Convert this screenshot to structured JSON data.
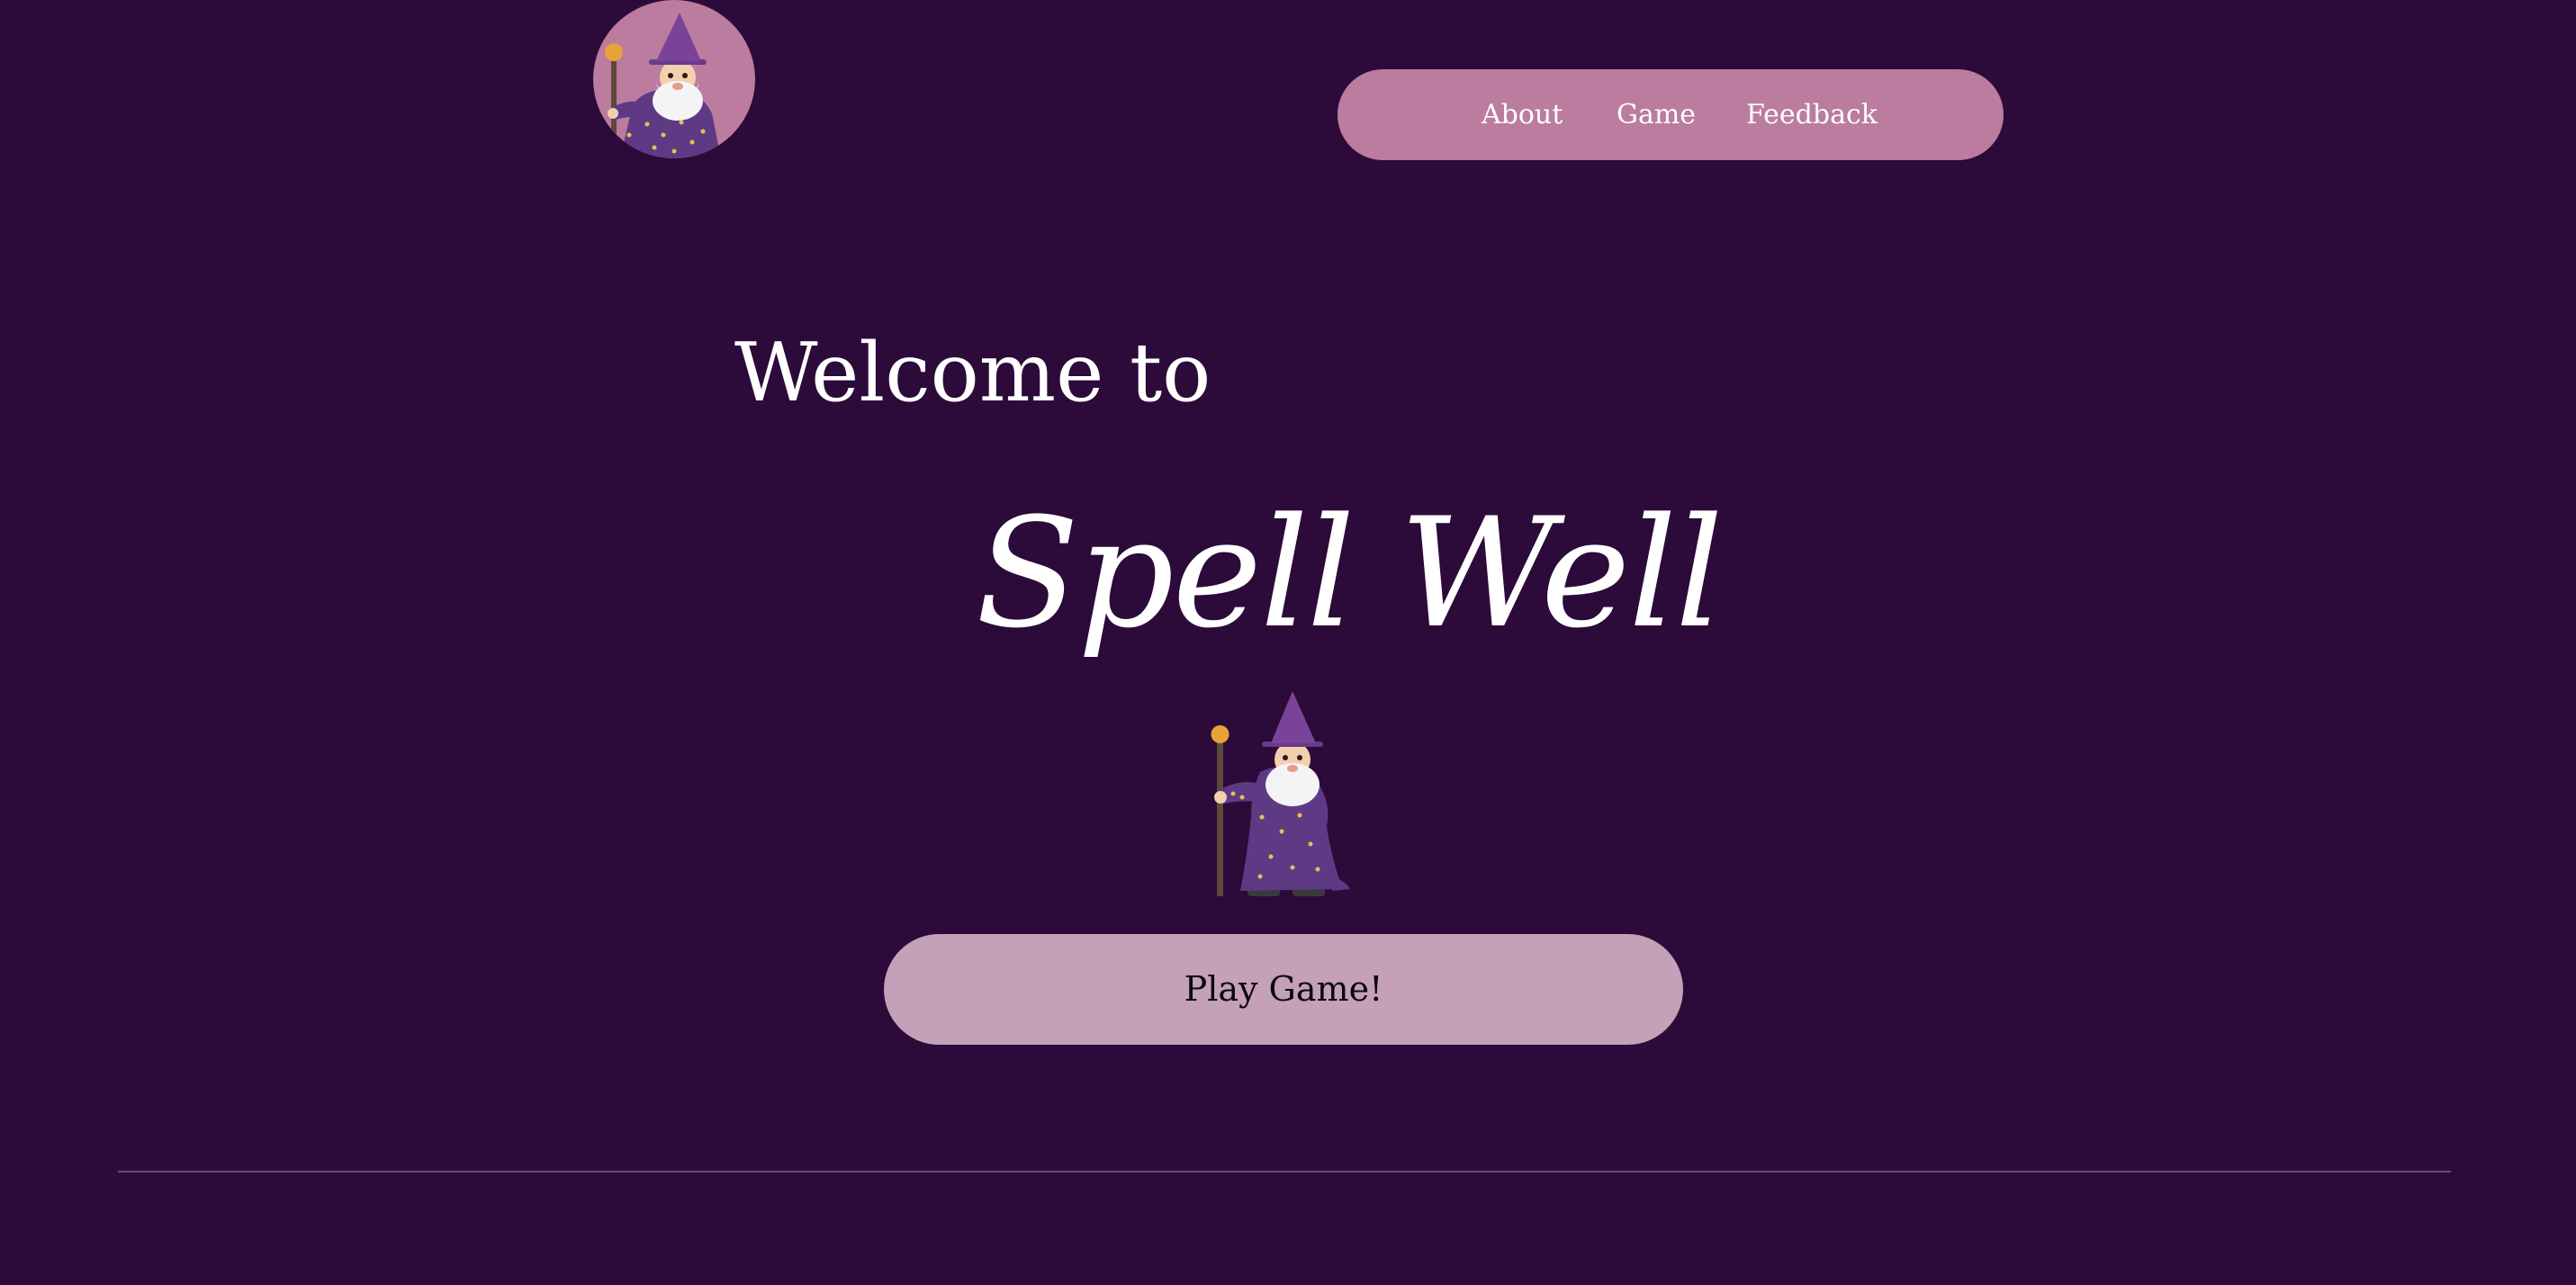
{
  "header": {
    "logo_icon": "wizard-icon",
    "nav": [
      {
        "label": "About"
      },
      {
        "label": "Game"
      },
      {
        "label": "Feedback"
      }
    ]
  },
  "hero": {
    "welcome": "Welcome to",
    "title": "Spell Well",
    "mascot_icon": "wizard-icon",
    "play_button": "Play Game!"
  },
  "colors": {
    "background": "#2c0a39",
    "nav_background": "#bb7c9f",
    "button_background": "#c4a0b9",
    "wizard_robe": "#5e3a85",
    "wizard_hat": "#7a4399",
    "staff_orb": "#e8a23a",
    "divider": "#6b4a78"
  }
}
